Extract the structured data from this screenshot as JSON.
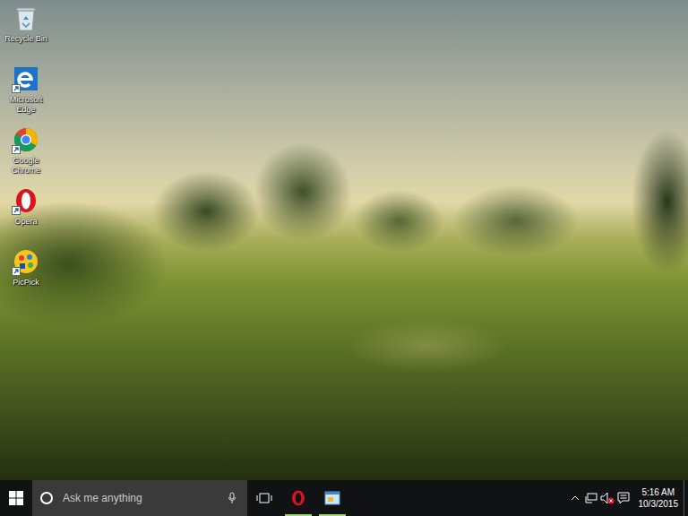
{
  "desktop": {
    "icons": [
      {
        "label": "Recycle Bin",
        "shortcut": false
      },
      {
        "label": "Microsoft Edge",
        "shortcut": true
      },
      {
        "label": "Google Chrome",
        "shortcut": true
      },
      {
        "label": "Opera",
        "shortcut": true
      },
      {
        "label": "PicPick",
        "shortcut": true
      }
    ]
  },
  "taskbar": {
    "search": {
      "placeholder": "Ask me anything"
    },
    "pinned_apps": [
      {
        "running": true
      },
      {
        "running": true
      }
    ],
    "tray": {
      "volume": {
        "muted": true
      },
      "clock": {
        "time": "5:16 AM",
        "date": "10/3/2015"
      }
    }
  }
}
